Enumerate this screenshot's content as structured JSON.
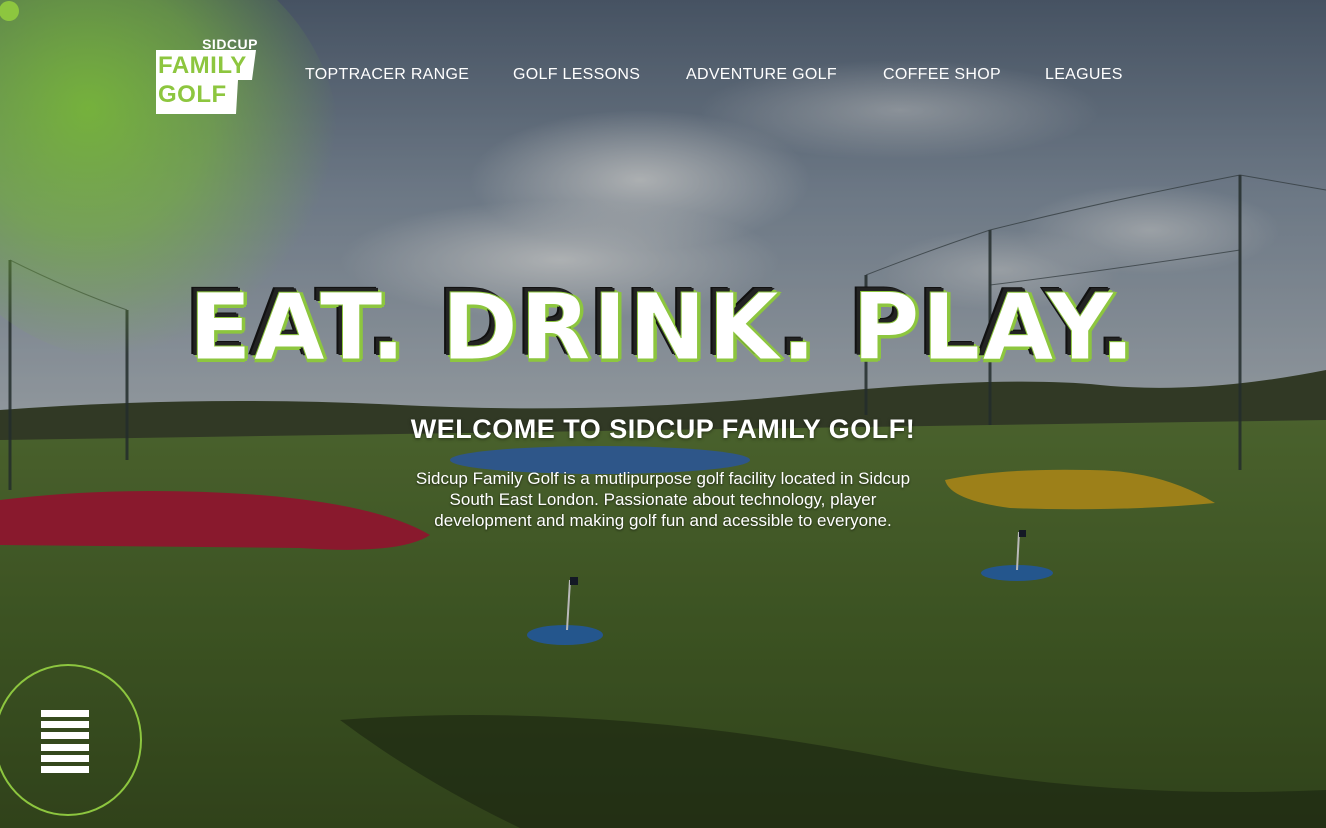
{
  "logo": {
    "top_text": "SIDCUP",
    "line1": "FAMILY",
    "line2": "GOLF",
    "brand_color": "#8dc63f"
  },
  "nav": {
    "items": [
      {
        "label": "TOPTRACER RANGE"
      },
      {
        "label": "GOLF LESSONS"
      },
      {
        "label": "ADVENTURE GOLF"
      },
      {
        "label": "COFFEE SHOP"
      },
      {
        "label": "LEAGUES"
      }
    ]
  },
  "hero": {
    "headline": "EAT. DRINK. PLAY.",
    "welcome": "WELCOME TO SIDCUP FAMILY GOLF!",
    "description": "Sidcup Family Golf is a mutlipurpose golf facility located in Sidcup South East London. Passionate about technology, player development and making golf fun and acessible to everyone."
  },
  "menu": {
    "icon": "hamburger-menu-icon"
  },
  "colors": {
    "accent": "#8dc63f",
    "text": "#ffffff"
  }
}
